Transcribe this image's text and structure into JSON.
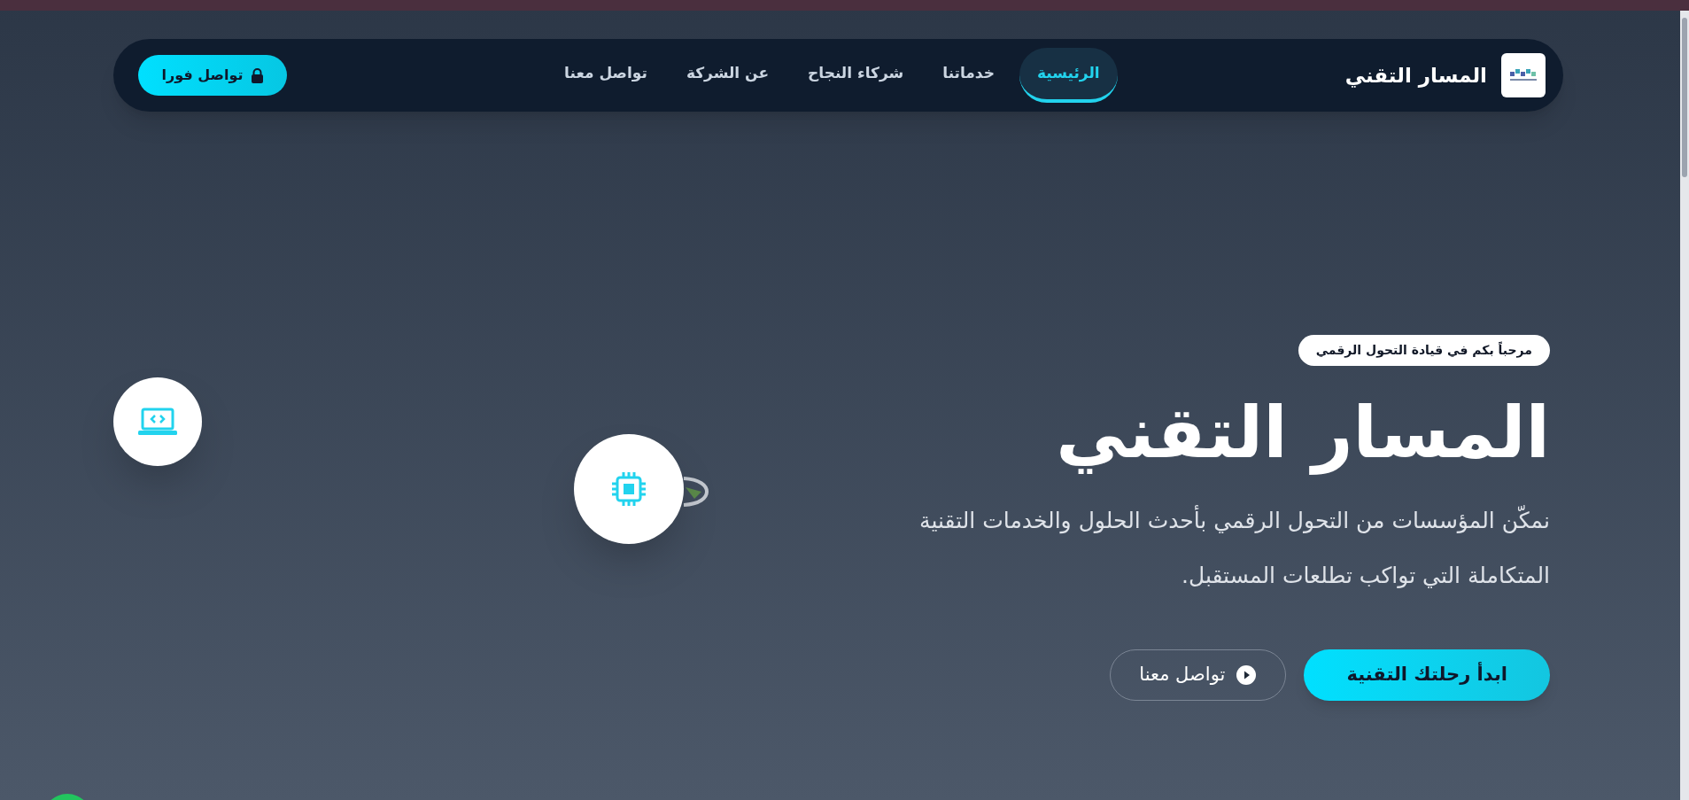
{
  "brand": {
    "name": "المسار التقني"
  },
  "nav": [
    {
      "label": "الرئيسية",
      "selected": true
    },
    {
      "label": "خدماتنا",
      "selected": false
    },
    {
      "label": "شركاء النجاح",
      "selected": false
    },
    {
      "label": "عن الشركة",
      "selected": false
    },
    {
      "label": "تواصل معنا",
      "selected": false
    }
  ],
  "cta": {
    "label": "تواصل فورا"
  },
  "hero": {
    "badge": "مرحباً بكم في قيادة التحول الرقمي",
    "title": "المسار التقني",
    "text": "نمكّن المؤسسات من التحول الرقمي بأحدث الحلول والخدمات التقنية المتكاملة التي تواكب تطلعات المستقبل.",
    "buttons": [
      {
        "kind": "primary",
        "label": "ابدأ رحلتك التقنية"
      },
      {
        "kind": "outline",
        "label": "تواصل معنا"
      }
    ]
  }
}
